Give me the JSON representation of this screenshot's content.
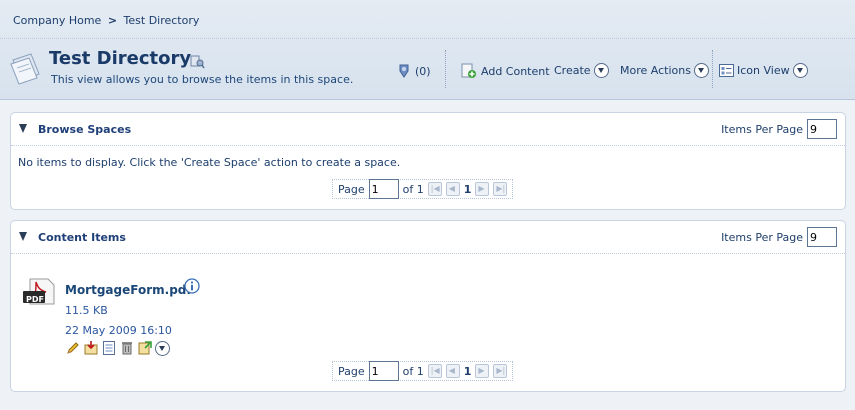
{
  "breadcrumb": {
    "home": "Company Home",
    "separator": ">",
    "current": "Test Directory"
  },
  "header": {
    "title": "Test Directory",
    "description": "This view allows you to browse the items in this space.",
    "rules_count": "(0)",
    "add_content": "Add Content",
    "create": "Create",
    "more_actions": "More Actions",
    "view_mode": "Icon View"
  },
  "browse_spaces": {
    "title": "Browse Spaces",
    "items_per_page_label": "Items Per Page",
    "items_per_page": "9",
    "empty_message": "No items to display. Click the 'Create Space' action to create a space.",
    "pager": {
      "page_label": "Page",
      "page": "1",
      "of_label": "of 1",
      "current": "1"
    }
  },
  "content_items": {
    "title": "Content Items",
    "items_per_page_label": "Items Per Page",
    "items_per_page": "9",
    "items": [
      {
        "name": "MortgageForm.pdf",
        "size": "11.5 KB",
        "date": "22 May 2009 16:10",
        "badge": "PDF"
      }
    ],
    "pager": {
      "page_label": "Page",
      "page": "1",
      "of_label": "of 1",
      "current": "1"
    }
  },
  "colors": {
    "header_bg": "#dbe4ef",
    "link": "#1f3f78",
    "pdf_red": "#c0141b"
  }
}
